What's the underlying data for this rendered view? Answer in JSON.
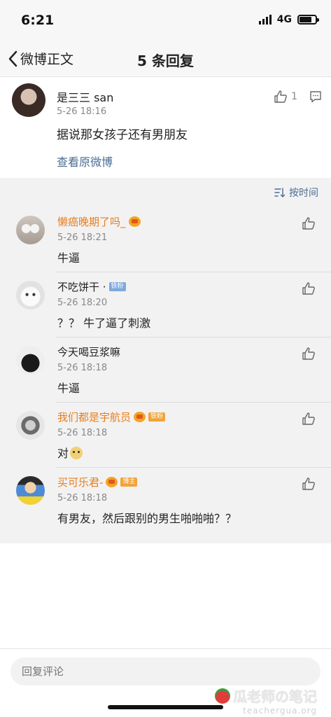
{
  "status_bar": {
    "time": "6:21",
    "network": "4G"
  },
  "nav": {
    "back_label": "微博正文",
    "title": "5 条回复"
  },
  "root_comment": {
    "author": "是三三 san",
    "time": "5-26 18:16",
    "text": "据说那女孩子还有男朋友",
    "like_count": "1",
    "view_original_link": "查看原微博"
  },
  "sort": {
    "label": "按时间"
  },
  "replies": [
    {
      "author": "懒癌晚期了吗_",
      "time": "5-26 18:21",
      "text": "牛逼",
      "badge": ""
    },
    {
      "author": "不吃饼干 ·",
      "time": "5-26 18:20",
      "text": "？？ 牛了逼了刺激",
      "badge": "铁粉"
    },
    {
      "author": "今天喝豆浆嘛",
      "time": "5-26 18:18",
      "text": "牛逼",
      "badge": ""
    },
    {
      "author": "我们都是宇航员",
      "time": "5-26 18:18",
      "text": "对",
      "badge": "铁粉"
    },
    {
      "author": "买可乐君-",
      "time": "5-26 18:18",
      "text": "有男友，然后跟别的男生啪啪啪？？",
      "badge": "博主"
    }
  ],
  "input": {
    "placeholder": "回复评论"
  },
  "watermark": {
    "title": "瓜老师の笔记",
    "subtitle": "teachergua.org"
  },
  "colors": {
    "link": "#4a6d93",
    "vip_name": "#e87d1c",
    "replies_bg": "#f2f2f2"
  }
}
